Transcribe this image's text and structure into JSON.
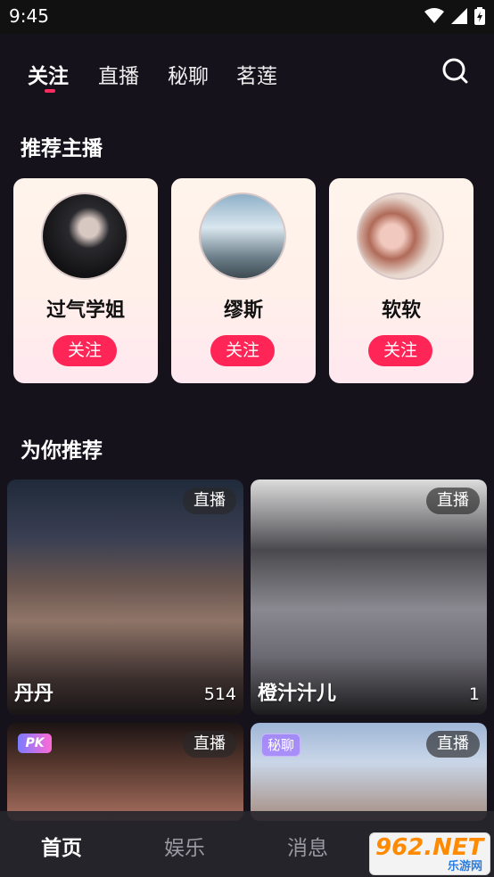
{
  "status_bar": {
    "time": "9:45"
  },
  "top_tabs": [
    {
      "label": "关注",
      "active": true
    },
    {
      "label": "直播",
      "active": false
    },
    {
      "label": "秘聊",
      "active": false
    },
    {
      "label": "茗莲",
      "active": false
    }
  ],
  "icons": {
    "search": "search-icon",
    "wifi": "wifi-icon",
    "signal": "signal-icon",
    "battery": "battery-icon"
  },
  "recommended_streamers": {
    "title": "推荐主播",
    "items": [
      {
        "name": "过气学姐",
        "follow_label": "关注"
      },
      {
        "name": "缪斯",
        "follow_label": "关注"
      },
      {
        "name": "软软",
        "follow_label": "关注"
      }
    ]
  },
  "for_you": {
    "title": "为你推荐",
    "items": [
      {
        "badge": "直播",
        "name": "丹丹",
        "count": "514"
      },
      {
        "badge": "直播",
        "name": "橙汁汁儿",
        "count": "1"
      },
      {
        "badge": "直播",
        "tag": "PK"
      },
      {
        "badge": "直播",
        "tag": "秘聊"
      }
    ]
  },
  "bottom_nav": [
    {
      "label": "首页",
      "active": true
    },
    {
      "label": "娱乐",
      "active": false
    },
    {
      "label": "消息",
      "active": false
    }
  ],
  "watermark": {
    "top": "962.NET",
    "bottom": "乐游网"
  },
  "colors": {
    "background": "#15121c",
    "accent": "#ff2556",
    "card": "#fff4ec"
  }
}
